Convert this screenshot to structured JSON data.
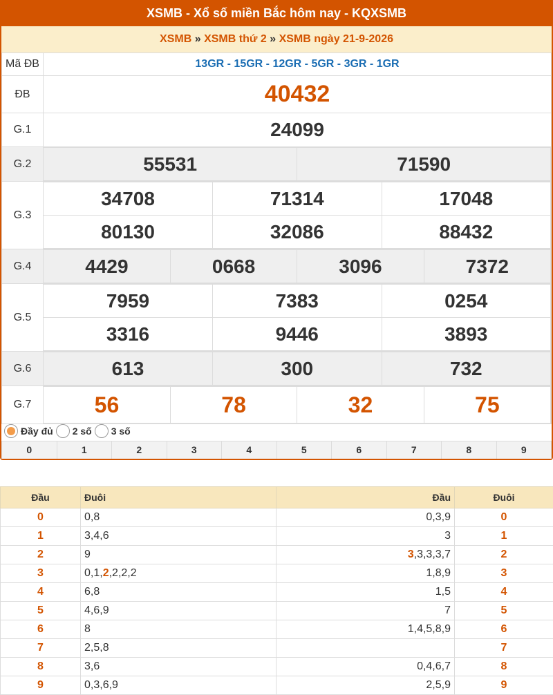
{
  "header": {
    "title": "XSMB - Xổ số miền Bắc hôm nay - KQXSMB"
  },
  "breadcrumb": {
    "link1": "XSMB",
    "sep": "»",
    "link2": "XSMB thứ 2",
    "link3": "XSMB ngày 21-9-2026"
  },
  "results": {
    "madb_label": "Mã ĐB",
    "madb_value": "13GR - 15GR - 12GR - 5GR - 3GR - 1GR",
    "db_label": "ĐB",
    "db": "40432",
    "g1_label": "G.1",
    "g1": "24099",
    "g2_label": "G.2",
    "g2": [
      "55531",
      "71590"
    ],
    "g3_label": "G.3",
    "g3": [
      "34708",
      "71314",
      "17048",
      "80130",
      "32086",
      "88432"
    ],
    "g4_label": "G.4",
    "g4": [
      "4429",
      "0668",
      "3096",
      "7372"
    ],
    "g5_label": "G.5",
    "g5": [
      "7959",
      "7383",
      "0254",
      "3316",
      "9446",
      "3893"
    ],
    "g6_label": "G.6",
    "g6": [
      "613",
      "300",
      "732"
    ],
    "g7_label": "G.7",
    "g7": [
      "56",
      "78",
      "32",
      "75"
    ]
  },
  "options": {
    "full": "Đầy đủ",
    "two": "2 số",
    "three": "3 số"
  },
  "digits": [
    "0",
    "1",
    "2",
    "3",
    "4",
    "5",
    "6",
    "7",
    "8",
    "9"
  ],
  "loto": {
    "h_dau": "Đầu",
    "h_duoi": "Đuôi",
    "h_dau2": "Đầu",
    "h_duoi2": "Đuôi",
    "rows": [
      {
        "d": "0",
        "t": "0,8",
        "t2": "0,3,9",
        "d2": "0"
      },
      {
        "d": "1",
        "t": "3,4,6",
        "t2": "3",
        "d2": "1"
      },
      {
        "d": "2",
        "t": "9",
        "t2a": "3",
        "t2b": ",3,3,3,7",
        "d2": "2"
      },
      {
        "d": "3",
        "ta": "0,1,",
        "tb": "2",
        "tc": ",2,2,2",
        "t2": "1,8,9",
        "d2": "3"
      },
      {
        "d": "4",
        "t": "6,8",
        "t2": "1,5",
        "d2": "4"
      },
      {
        "d": "5",
        "t": "4,6,9",
        "t2": "7",
        "d2": "5"
      },
      {
        "d": "6",
        "t": "8",
        "t2": "1,4,5,8,9",
        "d2": "6"
      },
      {
        "d": "7",
        "t": "2,5,8",
        "t2": "",
        "d2": "7"
      },
      {
        "d": "8",
        "t": "3,6",
        "t2": "0,4,6,7",
        "d2": "8"
      },
      {
        "d": "9",
        "t": "0,3,6,9",
        "t2": "2,5,9",
        "d2": "9"
      }
    ]
  }
}
